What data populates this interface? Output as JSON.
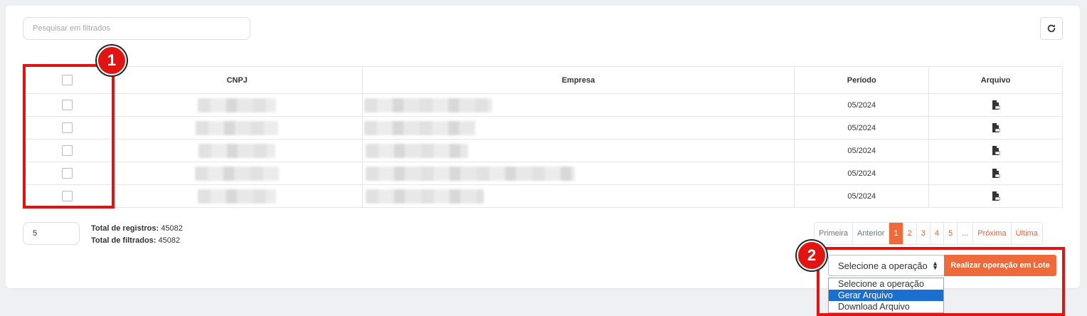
{
  "search": {
    "placeholder": "Pesquisar em filtrados",
    "value": ""
  },
  "refresh": {
    "icon": "refresh-icon"
  },
  "table": {
    "headers": [
      "",
      "CNPJ",
      "Empresa",
      "Período",
      "Arquivo"
    ],
    "rows": [
      {
        "periodo": "05/2024",
        "arquivo_icon": "pdf-file-icon"
      },
      {
        "periodo": "05/2024",
        "arquivo_icon": "pdf-file-icon"
      },
      {
        "periodo": "05/2024",
        "arquivo_icon": "pdf-file-icon"
      },
      {
        "periodo": "05/2024",
        "arquivo_icon": "pdf-file-icon"
      },
      {
        "periodo": "05/2024",
        "arquivo_icon": "pdf-file-icon"
      }
    ]
  },
  "footer": {
    "page_size": "5",
    "total_registros_label": "Total de registros:",
    "total_registros": "45082",
    "total_filtrados_label": "Total de filtrados:",
    "total_filtrados": "45082"
  },
  "pagination": {
    "first": "Primeira",
    "prev": "Anterior",
    "pages": [
      "1",
      "2",
      "3",
      "4",
      "5",
      "..."
    ],
    "current": "1",
    "next": "Próxima",
    "last": "Última"
  },
  "batch": {
    "select_value": "Selecione a operação",
    "button_label": "Realizar operação em Lote",
    "options": [
      "Selecione a operação",
      "Gerar Arquivo",
      "Download Arquivo"
    ],
    "highlighted_option": "Gerar Arquivo"
  },
  "annotations": {
    "badge_1": "1",
    "badge_2": "2",
    "color": "#e11414"
  },
  "colors": {
    "accent": "#ed6a3a",
    "option_highlight": "#1a6fd1"
  }
}
